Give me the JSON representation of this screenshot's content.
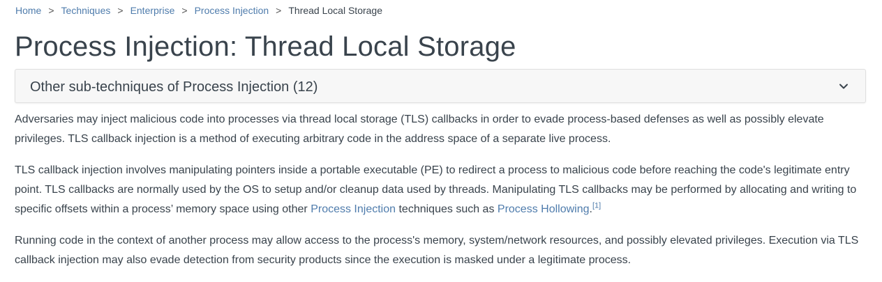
{
  "breadcrumb": {
    "items": [
      "Home",
      "Techniques",
      "Enterprise",
      "Process Injection"
    ],
    "current": "Thread Local Storage",
    "separator": ">"
  },
  "page_title": "Process Injection: Thread Local Storage",
  "accordion": {
    "label": "Other sub-techniques of Process Injection (12)",
    "icon": "chevron-down-icon"
  },
  "description": {
    "p1": "Adversaries may inject malicious code into processes via thread local storage (TLS) callbacks in order to evade process-based defenses as well as possibly elevate privileges. TLS callback injection is a method of executing arbitrary code in the address space of a separate live process.",
    "p2": {
      "text_before": "TLS callback injection involves manipulating pointers inside a portable executable (PE) to redirect a process to malicious code before reaching the code's legitimate entry point. TLS callbacks are normally used by the OS to setup and/or cleanup data used by threads. Manipulating TLS callbacks may be performed by allocating and writing to specific offsets within a process’ memory space using other ",
      "link1": "Process Injection",
      "text_middle": " techniques such as ",
      "link2": "Process Hollowing",
      "text_after": ".",
      "citation": "[1]"
    },
    "p3": "Running code in the context of another process may allow access to the process's memory, system/network resources, and possibly elevated privileges. Execution via TLS callback injection may also evade detection from security products since the execution is masked under a legitimate process."
  },
  "colors": {
    "link": "#4f7cac",
    "text": "#39434c",
    "accordion_bg": "#f7f7f7",
    "accordion_border": "#dfdfdf"
  }
}
